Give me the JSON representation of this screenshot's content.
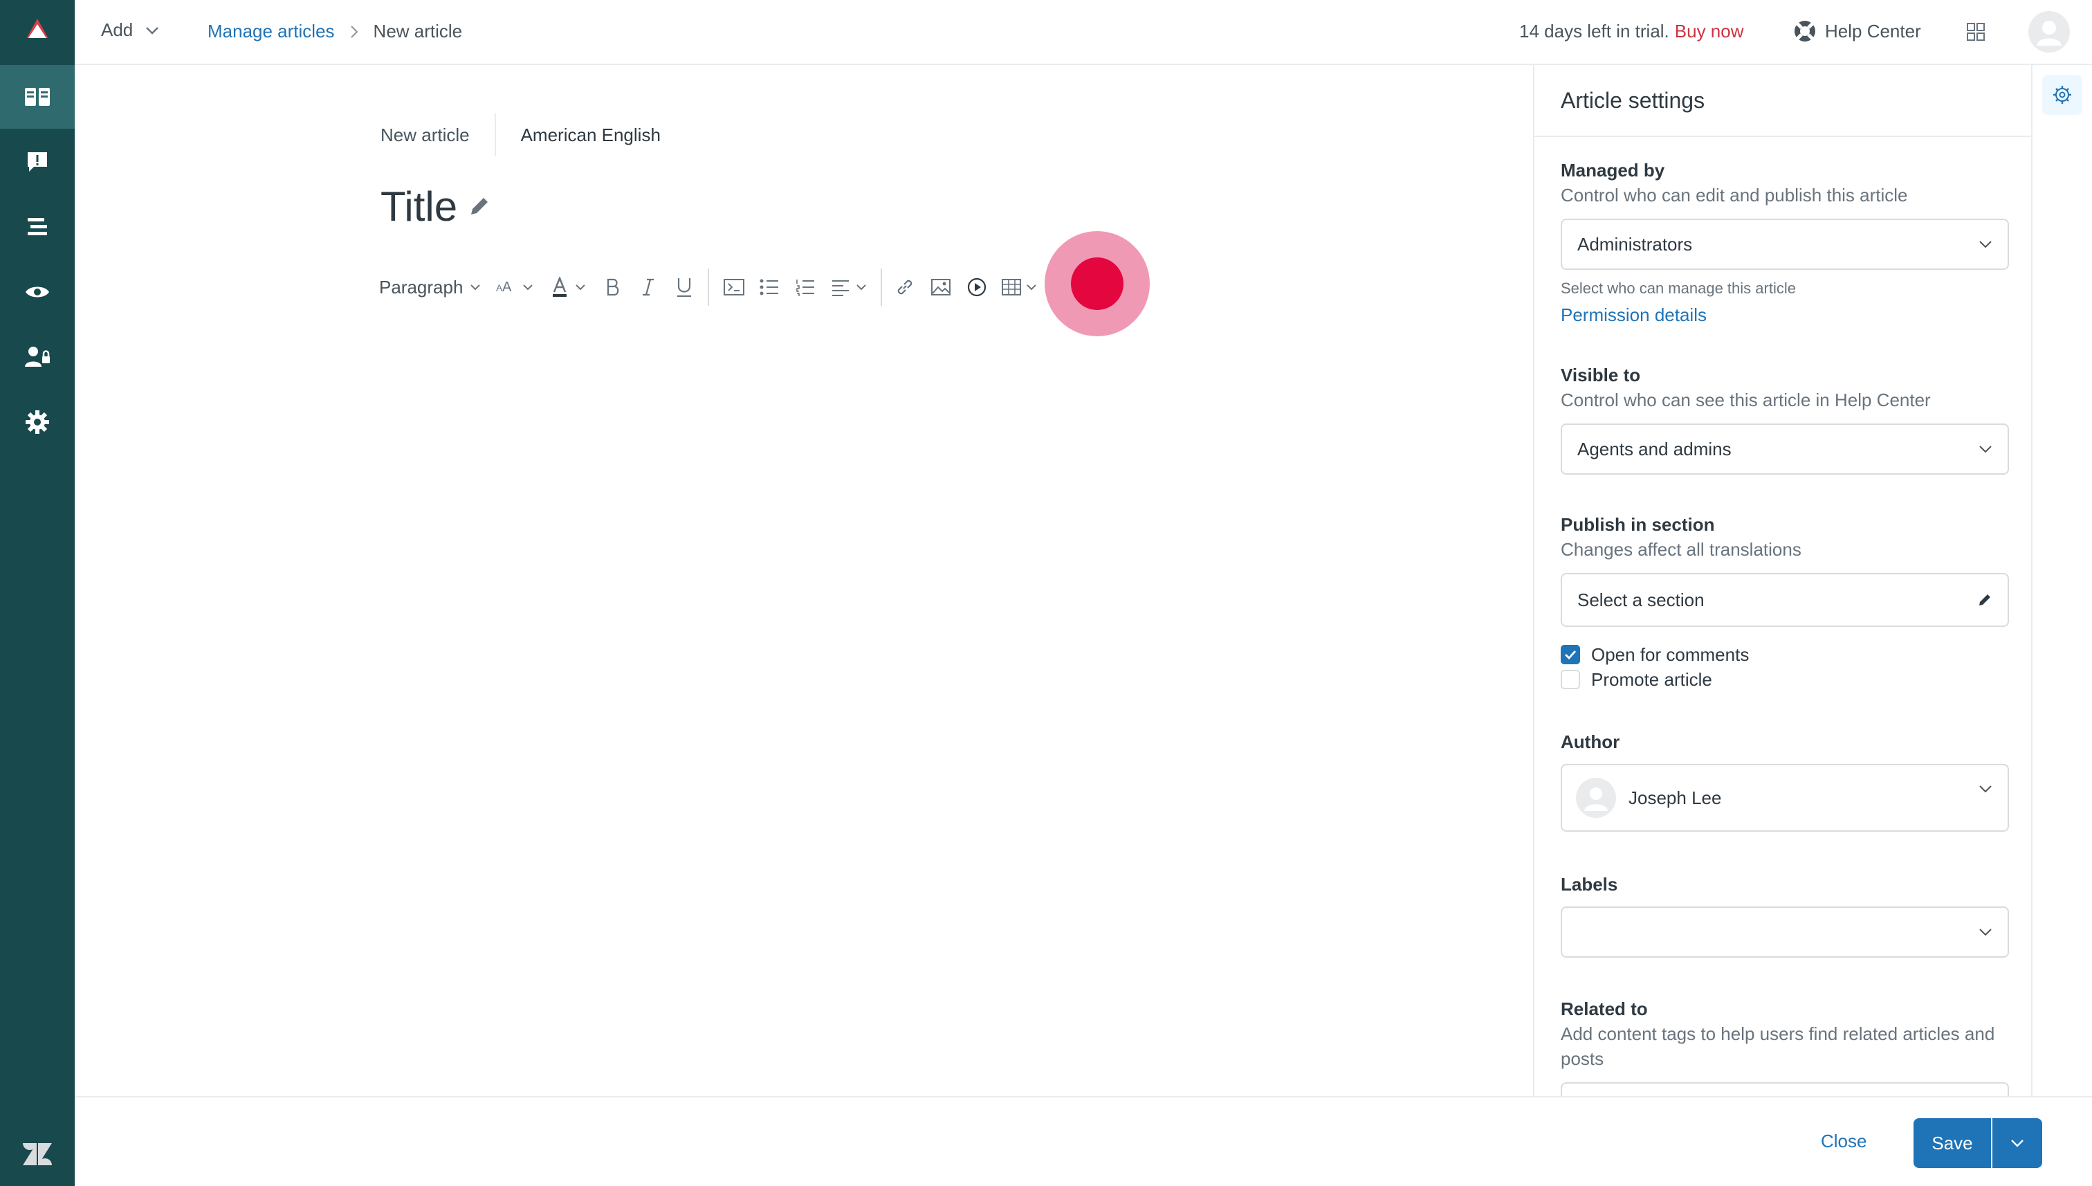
{
  "nav": {
    "items": [
      {
        "name": "guide-logo-icon"
      },
      {
        "name": "articles-icon",
        "active": true
      },
      {
        "name": "moderate-content-icon"
      },
      {
        "name": "arrange-content-icon"
      },
      {
        "name": "preview-icon"
      },
      {
        "name": "user-permissions-icon"
      },
      {
        "name": "settings-icon"
      }
    ],
    "footer_icon": "zendesk-logo-icon"
  },
  "topbar": {
    "add_label": "Add",
    "breadcrumb_link": "Manage articles",
    "breadcrumb_current": "New article",
    "trial_text": "14 days left in trial.",
    "buy_now": "Buy now",
    "help_center": "Help Center"
  },
  "editor": {
    "status": "New article",
    "language": "American English",
    "title_placeholder": "Title",
    "toolbar": {
      "paragraph": "Paragraph"
    }
  },
  "settings": {
    "heading": "Article settings",
    "managed_by": {
      "label": "Managed by",
      "hint": "Control who can edit and publish this article",
      "value": "Administrators",
      "small": "Select who can manage this article",
      "link": "Permission details"
    },
    "visible_to": {
      "label": "Visible to",
      "hint": "Control who can see this article in Help Center",
      "value": "Agents and admins"
    },
    "publish": {
      "label": "Publish in section",
      "hint": "Changes affect all translations",
      "value": "Select a section"
    },
    "checks": {
      "comments": "Open for comments",
      "comments_checked": true,
      "promote": "Promote article",
      "promote_checked": false
    },
    "author": {
      "label": "Author",
      "value": "Joseph Lee"
    },
    "labels": {
      "label": "Labels",
      "value": ""
    },
    "related": {
      "label": "Related to",
      "hint": "Add content tags to help users find related articles and posts"
    }
  },
  "footer": {
    "close": "Close",
    "save": "Save"
  },
  "colors": {
    "rail": "#17494d",
    "accent": "#1f73b7",
    "buy_now": "#cc3340",
    "pointer": "#e3063f"
  }
}
